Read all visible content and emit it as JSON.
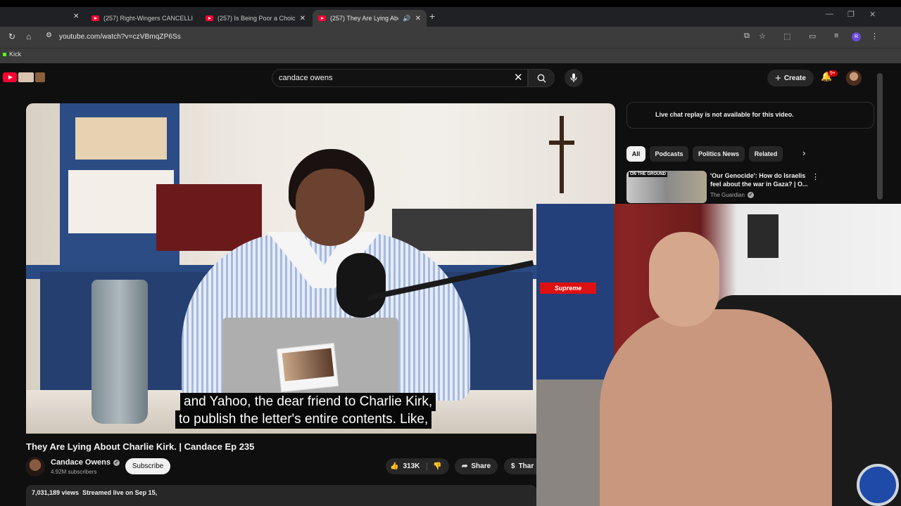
{
  "browser": {
    "tabs": [
      {
        "title": "(257) Right-Wingers CANCELLIN",
        "active": false
      },
      {
        "title": "(257) Is Being Poor a Choice? U",
        "active": false
      },
      {
        "title": "(257) They Are Lying About",
        "active": true
      }
    ],
    "url": "youtube.com/watch?v=czVBmqZP6Ss",
    "bookmarks": [
      "Kick"
    ],
    "profile_initial": "R"
  },
  "youtube": {
    "search_value": "candace owens",
    "create_label": "Create",
    "notifications_badge": "9+",
    "video": {
      "caption_line1": "and Yahoo, the dear friend to Charlie Kirk,",
      "caption_line2": "to publish the letter's entire contents. Like,",
      "title": "They Are Lying About Charlie Kirk. | Candace Ep 235",
      "channel_name": "Candace Owens",
      "subscribers": "4.92M subscribers",
      "subscribe_label": "Subscribe",
      "likes": "313K",
      "share_label": "Share",
      "thanks_label": "Thar",
      "views": "7,031,189 views",
      "streamed": "Streamed live on Sep 15,"
    },
    "chat_notice": "Live chat replay is not available for this video.",
    "chips": [
      "All",
      "Podcasts",
      "Politics News",
      "Related"
    ],
    "recommendation": {
      "thumb_label": "ON THE GROUND",
      "title": "'Our Genocide': How do Israelis feel about the war in Gaza? | O...",
      "channel": "The Guardian"
    }
  },
  "webcam": {
    "sign_text": "Supreme"
  },
  "colors": {
    "youtube_red": "#ff0033",
    "background": "#0f0f0f",
    "chip_selected": "#f1f1f1"
  }
}
